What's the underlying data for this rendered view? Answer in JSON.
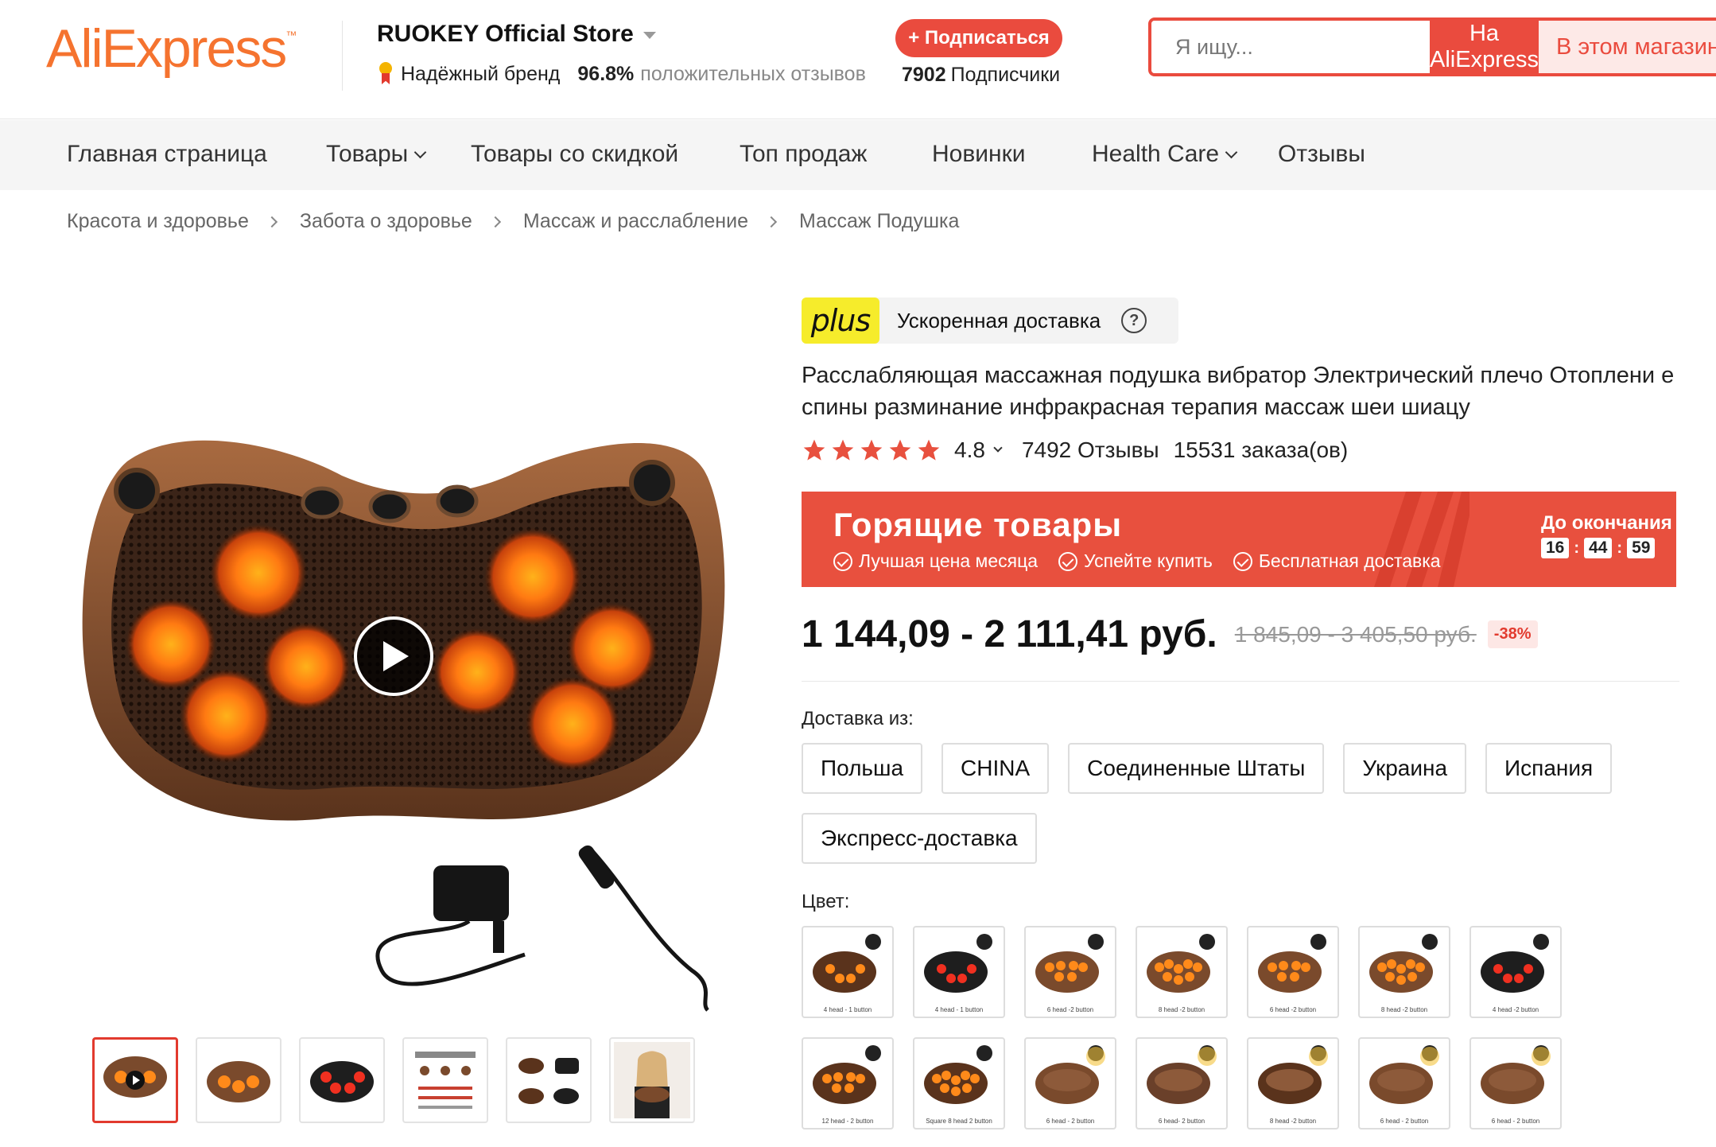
{
  "header": {
    "logo": "AliExpress",
    "logo_tm": "™",
    "store_name": "RUOKEY Official Store",
    "brand_label": "Надёжный бренд",
    "positive_pct": "96.8%",
    "positive_label": "положительных отзывов",
    "subscribe_label": "+ Подписаться",
    "subscribers_count": "7902",
    "subscribers_label": "Подписчики",
    "search_placeholder": "Я ищу...",
    "search_ali_label": "На AliExpress",
    "search_store_label": "В этом магазине"
  },
  "nav": {
    "items": [
      {
        "label": "Главная страница"
      },
      {
        "label": "Товары"
      },
      {
        "label": "Товары со скидкой"
      },
      {
        "label": "Топ продаж"
      },
      {
        "label": "Новинки"
      },
      {
        "label": "Health Care"
      },
      {
        "label": "Отзывы"
      }
    ]
  },
  "breadcrumb": [
    "Красота и здоровье",
    "Забота о здоровье",
    "Массаж и расслабление",
    "Массаж Подушка"
  ],
  "product": {
    "plus_badge": "plus",
    "plus_text": "Ускоренная доставка",
    "help": "?",
    "title": "Расслабляющая массажная подушка вибратор Электрический плечо Отоплени е спины разминание инфракрасная терапия массаж шеи шиацу",
    "rating": "4.8",
    "reviews": "7492 Отзывы",
    "orders": "15531 заказа(ов)",
    "hot_title": "Горящие товары",
    "hot_features": [
      "Лучшая цена месяца",
      "Успейте купить",
      "Бесплатная доставка"
    ],
    "countdown_label": "До окончания",
    "timer": [
      "16",
      "44",
      "59"
    ],
    "price": "1 144,09 - 2 111,41 руб.",
    "old_price": "1 845,09 - 3 405,50 руб.",
    "discount": "-38%",
    "ship_label": "Доставка из:",
    "ship_options": [
      "Польша",
      "CHINA",
      "Соединенные Штаты",
      "Украина",
      "Испания",
      "Экспресс-доставка"
    ],
    "color_label": "Цвет:",
    "color_swatch_captions": [
      "4 head - 1 button",
      "4 head - 1 button",
      "6 head -2 button",
      "8 head -2 button",
      "6 head -2 button",
      "8 head -2 button",
      "4 head -2 button",
      "12 head - 2 button",
      "Square 8 head 2 button",
      "6 head - 2 button",
      "6 head- 2 button",
      "8 head -2 button",
      "6 head - 2 button",
      "6 head - 2 button"
    ]
  },
  "colors": {
    "accent": "#ea4b3e",
    "logo_orange": "#f5732f",
    "pillow_brown": "#7a4a2c",
    "pillow_black": "#1e1e1e",
    "plus_yellow": "#f6ec2b",
    "star": "#e8503e"
  }
}
